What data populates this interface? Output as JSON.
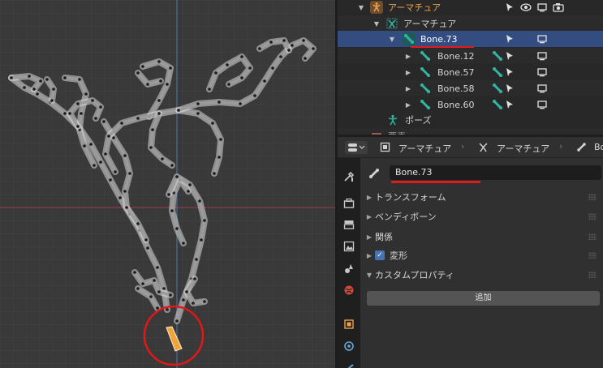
{
  "outliner": {
    "armature_object": "アーマチュア",
    "armature_data": "アーマチュア",
    "selected_bone": "Bone.73",
    "child_bones": [
      "Bone.12",
      "Bone.57",
      "Bone.58",
      "Bone.60"
    ],
    "pose": "ポーズ",
    "partial_row": "要素"
  },
  "properties": {
    "breadcrumb": [
      "アーマチュア",
      "アーマチュア",
      "Bo"
    ],
    "bone_name": "Bone.73",
    "panels": {
      "transform": "トランスフォーム",
      "bendy_bones": "ベンディボーン",
      "relations": "関係",
      "deform": "変形",
      "custom_props": "カスタムプロパティ"
    },
    "add_label": "追加"
  },
  "colors": {
    "selection_highlight": "#334d80",
    "bone_icon": "#30b6a3",
    "armature_icon": "#e8a04a",
    "annotation_red": "#e11b1b",
    "active_bone": "#f2a23a"
  },
  "icons": [
    "armature-icon",
    "bone-icon",
    "cursor-arrow-icon",
    "eye-icon",
    "camera-icon",
    "monitor-icon",
    "pose-icon",
    "wrench-icon"
  ]
}
